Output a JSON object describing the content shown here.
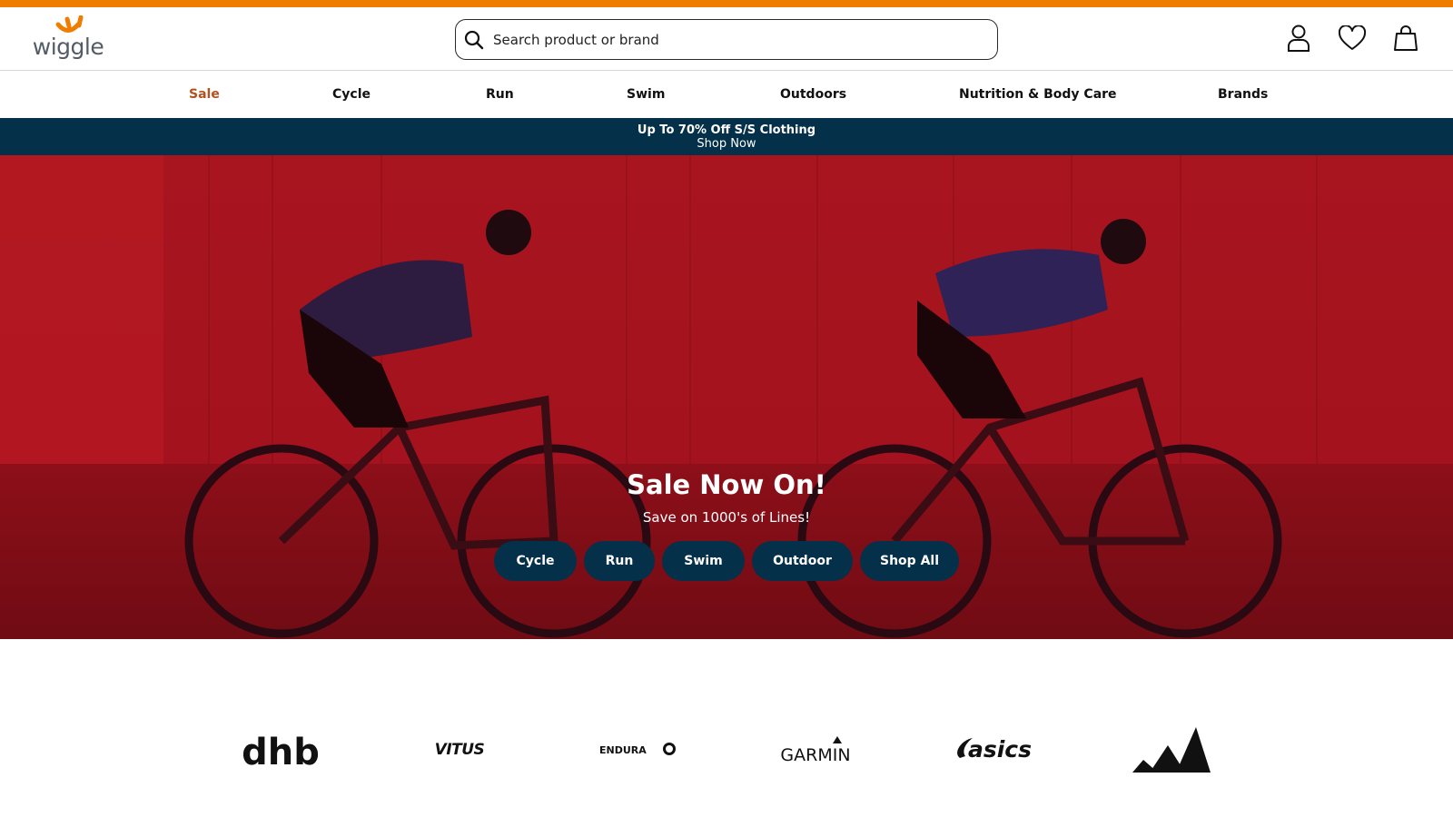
{
  "colors": {
    "accent_stripe": "#ef7d00",
    "sale_nav": "#b2501e",
    "promo_bg": "#04304a",
    "hero_tint": "#9a1520",
    "hero_button_bg": "#04304a"
  },
  "header": {
    "logo_text": "wiggle",
    "search_placeholder": "Search product or brand",
    "icons": [
      "account-icon",
      "heart-icon",
      "bag-icon"
    ]
  },
  "nav": {
    "items": [
      {
        "label": "Sale"
      },
      {
        "label": "Cycle"
      },
      {
        "label": "Run"
      },
      {
        "label": "Swim"
      },
      {
        "label": "Outdoors"
      },
      {
        "label": "Nutrition & Body Care"
      },
      {
        "label": "Brands"
      }
    ]
  },
  "promo": {
    "title": "Up To 70% Off S/S Clothing",
    "link": "Shop Now"
  },
  "hero": {
    "title": "Sale Now On!",
    "subtitle": "Save on 1000's of Lines!",
    "buttons": [
      {
        "label": "Cycle"
      },
      {
        "label": "Run"
      },
      {
        "label": "Swim"
      },
      {
        "label": "Outdoor"
      },
      {
        "label": "Shop All"
      }
    ]
  },
  "brands": {
    "logos": [
      {
        "name": "dhb-logo",
        "text": "dhb"
      },
      {
        "name": "vitus-logo",
        "text": "VITUS"
      },
      {
        "name": "endura-logo",
        "text": "ENDURA"
      },
      {
        "name": "garmin-logo",
        "text": "GARMIN"
      },
      {
        "name": "asics-logo",
        "text": "asics"
      },
      {
        "name": "adidas-logo",
        "text": ""
      }
    ]
  }
}
